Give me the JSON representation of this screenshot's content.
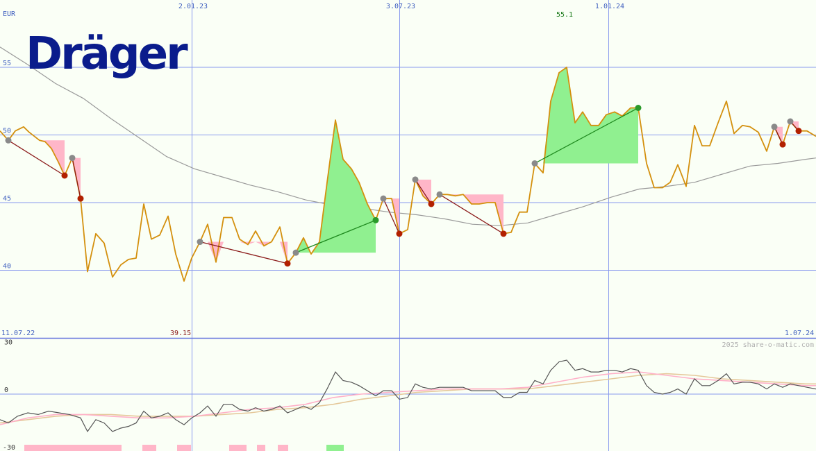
{
  "header": {
    "currency": "EUR",
    "logo_text": "Dräger",
    "copyright": "2025 share-o-matic.com"
  },
  "colors": {
    "background": "#fafff6",
    "grid": "#8899ee",
    "price_line": "#d4900e",
    "moving_average": "#9a9a9a",
    "gain_fill": "#90f090",
    "loss_fill": "#ffb6c8",
    "gain_marker": "#2a9a2a",
    "loss_marker": "#b22000",
    "start_marker": "#8a8a8a",
    "loss_trend": "#8b1a1a",
    "gain_trend": "#1f8a1f",
    "osc_line": "#555555",
    "osc_pink": "#ffb0c8",
    "osc_tan": "#e5c89a",
    "logo": "#0a1c8c",
    "max_label": "#1a7a1a",
    "min_label": "#8b1a1a"
  },
  "chart_data": [
    {
      "type": "line",
      "name": "price",
      "x_range": [
        0,
        1175
      ],
      "ylim": [
        35,
        57.5
      ],
      "y_ticks": [
        40,
        45,
        50,
        55
      ],
      "x_tick_labels": [
        {
          "label": "2.01.23",
          "x": 278
        },
        {
          "label": "3.07.23",
          "x": 577
        },
        {
          "label": "1.01.24",
          "x": 878
        }
      ],
      "date_labels": {
        "start": "11.07.22",
        "end": "1.07.24"
      },
      "max_label": "55.1",
      "min_label": "39.15",
      "price": [
        [
          0,
          50.3
        ],
        [
          12,
          49.6
        ],
        [
          22,
          50.3
        ],
        [
          34,
          50.6
        ],
        [
          42,
          50.2
        ],
        [
          57,
          49.6
        ],
        [
          65,
          49.5
        ],
        [
          74,
          49
        ],
        [
          84,
          48
        ],
        [
          93,
          47
        ],
        [
          104,
          48.3
        ],
        [
          116,
          45.3
        ],
        [
          126,
          39.9
        ],
        [
          138,
          42.7
        ],
        [
          150,
          42
        ],
        [
          162,
          39.5
        ],
        [
          174,
          40.4
        ],
        [
          185,
          40.8
        ],
        [
          196,
          40.9
        ],
        [
          207,
          44.9
        ],
        [
          218,
          42.3
        ],
        [
          230,
          42.6
        ],
        [
          242,
          44
        ],
        [
          253,
          41.2
        ],
        [
          265,
          39.2
        ],
        [
          276,
          40.9
        ],
        [
          288,
          42.1
        ],
        [
          299,
          43.4
        ],
        [
          311,
          40.6
        ],
        [
          322,
          43.9
        ],
        [
          334,
          43.9
        ],
        [
          345,
          42.3
        ],
        [
          357,
          41.9
        ],
        [
          368,
          42.9
        ],
        [
          380,
          41.8
        ],
        [
          391,
          42.1
        ],
        [
          403,
          43.2
        ],
        [
          414,
          40.5
        ],
        [
          426,
          41.3
        ],
        [
          437,
          42.4
        ],
        [
          448,
          41.2
        ],
        [
          460,
          42.1
        ],
        [
          471,
          46.5
        ],
        [
          483,
          51.1
        ],
        [
          494,
          48.2
        ],
        [
          506,
          47.5
        ],
        [
          517,
          46.5
        ],
        [
          529,
          44.9
        ],
        [
          541,
          43.7
        ],
        [
          552,
          45.3
        ],
        [
          564,
          45.3
        ],
        [
          575,
          42.7
        ],
        [
          587,
          43
        ],
        [
          598,
          46.7
        ],
        [
          609,
          45.5
        ],
        [
          621,
          44.9
        ],
        [
          633,
          45.6
        ],
        [
          644,
          45.6
        ],
        [
          656,
          45.5
        ],
        [
          667,
          45.6
        ],
        [
          679,
          44.9
        ],
        [
          690,
          44.9
        ],
        [
          702,
          45
        ],
        [
          713,
          45
        ],
        [
          725,
          42.7
        ],
        [
          736,
          42.8
        ],
        [
          748,
          44.3
        ],
        [
          759,
          44.3
        ],
        [
          770,
          47.9
        ],
        [
          782,
          47.2
        ],
        [
          793,
          52.5
        ],
        [
          805,
          54.6
        ],
        [
          816,
          55
        ],
        [
          828,
          50.9
        ],
        [
          839,
          51.7
        ],
        [
          851,
          50.7
        ],
        [
          862,
          50.7
        ],
        [
          873,
          51.5
        ],
        [
          885,
          51.7
        ],
        [
          896,
          51.4
        ],
        [
          908,
          52
        ],
        [
          919,
          52
        ],
        [
          931,
          47.9
        ],
        [
          942,
          46.1
        ],
        [
          954,
          46.1
        ],
        [
          965,
          46.5
        ],
        [
          976,
          47.8
        ],
        [
          988,
          46.2
        ],
        [
          1000,
          50.7
        ],
        [
          1011,
          49.2
        ],
        [
          1022,
          49.2
        ],
        [
          1034,
          50.9
        ],
        [
          1046,
          52.5
        ],
        [
          1057,
          50.1
        ],
        [
          1069,
          50.7
        ],
        [
          1080,
          50.6
        ],
        [
          1092,
          50.2
        ],
        [
          1104,
          48.8
        ],
        [
          1115,
          50.6
        ],
        [
          1127,
          49.3
        ],
        [
          1138,
          51
        ],
        [
          1150,
          50.3
        ],
        [
          1162,
          50.3
        ],
        [
          1175,
          49.9
        ]
      ],
      "moving_average": [
        [
          0,
          56.5
        ],
        [
          40,
          55.2
        ],
        [
          80,
          53.8
        ],
        [
          120,
          52.7
        ],
        [
          160,
          51.2
        ],
        [
          200,
          49.8
        ],
        [
          240,
          48.4
        ],
        [
          280,
          47.5
        ],
        [
          320,
          46.9
        ],
        [
          360,
          46.3
        ],
        [
          400,
          45.8
        ],
        [
          440,
          45.2
        ],
        [
          480,
          44.8
        ],
        [
          520,
          44.6
        ],
        [
          560,
          44.3
        ],
        [
          600,
          44.1
        ],
        [
          640,
          43.8
        ],
        [
          680,
          43.4
        ],
        [
          720,
          43.3
        ],
        [
          760,
          43.5
        ],
        [
          800,
          44.1
        ],
        [
          840,
          44.7
        ],
        [
          880,
          45.4
        ],
        [
          920,
          46
        ],
        [
          960,
          46.2
        ],
        [
          1000,
          46.5
        ],
        [
          1040,
          47.1
        ],
        [
          1080,
          47.7
        ],
        [
          1120,
          47.9
        ],
        [
          1160,
          48.2
        ],
        [
          1175,
          48.3
        ]
      ],
      "signals": [
        {
          "kind": "loss",
          "x1": 12,
          "y1": 49.6,
          "x2": 93,
          "y2": 47,
          "fill_x": [
            12,
            93
          ],
          "fill_top": 49.6
        },
        {
          "kind": "loss",
          "x1": 104,
          "y1": 48.3,
          "x2": 116,
          "y2": 45.3,
          "fill_x": [
            104,
            116
          ],
          "fill_top": 48.3
        },
        {
          "kind": "loss",
          "x1": 288,
          "y1": 42.1,
          "x2": 414,
          "y2": 40.5,
          "fill_x": [
            288,
            414
          ],
          "fill_top": 42.1
        },
        {
          "kind": "gain",
          "x1": 426,
          "y1": 41.3,
          "x2": 541,
          "y2": 43.7,
          "fill_x": [
            426,
            541
          ],
          "fill_bottom": 41.3
        },
        {
          "kind": "loss",
          "x1": 552,
          "y1": 45.3,
          "x2": 575,
          "y2": 42.7,
          "fill_x": [
            552,
            575
          ],
          "fill_top": 45.3
        },
        {
          "kind": "loss",
          "x1": 598,
          "y1": 46.7,
          "x2": 621,
          "y2": 44.9,
          "fill_x": [
            598,
            621
          ],
          "fill_top": 46.7
        },
        {
          "kind": "loss",
          "x1": 633,
          "y1": 45.6,
          "x2": 725,
          "y2": 42.7,
          "fill_x": [
            633,
            725
          ],
          "fill_top": 45.6
        },
        {
          "kind": "gain",
          "x1": 770,
          "y1": 47.9,
          "x2": 919,
          "y2": 52,
          "fill_x": [
            770,
            919
          ],
          "fill_bottom": 47.9
        },
        {
          "kind": "loss",
          "x1": 1115,
          "y1": 50.6,
          "x2": 1127,
          "y2": 49.3,
          "fill_x": [
            1115,
            1127
          ],
          "fill_top": 50.6
        },
        {
          "kind": "loss",
          "x1": 1138,
          "y1": 51,
          "x2": 1150,
          "y2": 50.3,
          "fill_x": [
            1138,
            1150
          ],
          "fill_top": 51
        }
      ]
    },
    {
      "type": "line",
      "name": "oscillator",
      "ylim": [
        -32,
        33
      ],
      "y_ticks": [
        30,
        0,
        -30
      ],
      "series_main": [
        [
          0,
          -15
        ],
        [
          12,
          -17
        ],
        [
          25,
          -13
        ],
        [
          40,
          -11
        ],
        [
          55,
          -12
        ],
        [
          70,
          -10
        ],
        [
          85,
          -11
        ],
        [
          100,
          -12
        ],
        [
          116,
          -14
        ],
        [
          126,
          -22
        ],
        [
          138,
          -15
        ],
        [
          150,
          -17
        ],
        [
          162,
          -22
        ],
        [
          174,
          -20
        ],
        [
          185,
          -19
        ],
        [
          196,
          -17
        ],
        [
          207,
          -10
        ],
        [
          218,
          -14
        ],
        [
          230,
          -13
        ],
        [
          242,
          -11
        ],
        [
          253,
          -15
        ],
        [
          265,
          -18
        ],
        [
          276,
          -14
        ],
        [
          288,
          -11
        ],
        [
          299,
          -7
        ],
        [
          311,
          -13
        ],
        [
          322,
          -6
        ],
        [
          334,
          -6
        ],
        [
          345,
          -9
        ],
        [
          357,
          -10
        ],
        [
          368,
          -8
        ],
        [
          380,
          -10
        ],
        [
          391,
          -9
        ],
        [
          403,
          -7
        ],
        [
          414,
          -11
        ],
        [
          426,
          -9
        ],
        [
          437,
          -7
        ],
        [
          448,
          -9
        ],
        [
          460,
          -5
        ],
        [
          471,
          3
        ],
        [
          483,
          13
        ],
        [
          494,
          8
        ],
        [
          506,
          7
        ],
        [
          517,
          5
        ],
        [
          529,
          2
        ],
        [
          541,
          -1
        ],
        [
          552,
          2
        ],
        [
          564,
          2
        ],
        [
          575,
          -3
        ],
        [
          587,
          -2
        ],
        [
          598,
          6
        ],
        [
          609,
          4
        ],
        [
          621,
          3
        ],
        [
          633,
          4
        ],
        [
          644,
          4
        ],
        [
          656,
          4
        ],
        [
          667,
          4
        ],
        [
          679,
          2
        ],
        [
          690,
          2
        ],
        [
          702,
          2
        ],
        [
          713,
          2
        ],
        [
          725,
          -2
        ],
        [
          736,
          -2
        ],
        [
          748,
          1
        ],
        [
          759,
          1
        ],
        [
          770,
          8
        ],
        [
          782,
          6
        ],
        [
          793,
          14
        ],
        [
          805,
          19
        ],
        [
          816,
          20
        ],
        [
          828,
          14
        ],
        [
          839,
          15
        ],
        [
          851,
          13
        ],
        [
          862,
          13
        ],
        [
          873,
          14
        ],
        [
          885,
          14
        ],
        [
          896,
          13
        ],
        [
          908,
          15
        ],
        [
          919,
          14
        ],
        [
          931,
          5
        ],
        [
          942,
          1
        ],
        [
          954,
          0
        ],
        [
          965,
          1
        ],
        [
          976,
          3
        ],
        [
          988,
          0
        ],
        [
          1000,
          9
        ],
        [
          1011,
          5
        ],
        [
          1022,
          5
        ],
        [
          1034,
          8
        ],
        [
          1046,
          12
        ],
        [
          1057,
          6
        ],
        [
          1069,
          7
        ],
        [
          1080,
          7
        ],
        [
          1092,
          6
        ],
        [
          1104,
          3
        ],
        [
          1115,
          6
        ],
        [
          1127,
          4
        ],
        [
          1138,
          6
        ],
        [
          1150,
          5
        ],
        [
          1162,
          4
        ],
        [
          1175,
          3
        ]
      ],
      "series_pink": [
        [
          0,
          -18
        ],
        [
          40,
          -14
        ],
        [
          80,
          -12
        ],
        [
          120,
          -12
        ],
        [
          160,
          -13
        ],
        [
          200,
          -14
        ],
        [
          240,
          -14
        ],
        [
          280,
          -13
        ],
        [
          320,
          -11
        ],
        [
          360,
          -9
        ],
        [
          400,
          -8
        ],
        [
          440,
          -6
        ],
        [
          480,
          -2
        ],
        [
          520,
          0
        ],
        [
          560,
          1
        ],
        [
          600,
          2
        ],
        [
          640,
          3
        ],
        [
          680,
          3
        ],
        [
          720,
          3
        ],
        [
          760,
          4
        ],
        [
          800,
          7
        ],
        [
          840,
          10
        ],
        [
          880,
          12
        ],
        [
          920,
          13
        ],
        [
          960,
          11
        ],
        [
          1000,
          9
        ],
        [
          1040,
          8
        ],
        [
          1080,
          7
        ],
        [
          1120,
          6
        ],
        [
          1160,
          5
        ],
        [
          1175,
          5
        ]
      ],
      "series_tan": [
        [
          0,
          -17
        ],
        [
          40,
          -15
        ],
        [
          80,
          -13
        ],
        [
          120,
          -12
        ],
        [
          160,
          -12
        ],
        [
          200,
          -13
        ],
        [
          240,
          -13
        ],
        [
          280,
          -13
        ],
        [
          320,
          -12
        ],
        [
          360,
          -11
        ],
        [
          400,
          -9
        ],
        [
          440,
          -8
        ],
        [
          480,
          -6
        ],
        [
          520,
          -3
        ],
        [
          560,
          -1
        ],
        [
          600,
          1
        ],
        [
          640,
          2
        ],
        [
          680,
          3
        ],
        [
          720,
          3
        ],
        [
          760,
          3
        ],
        [
          800,
          5
        ],
        [
          840,
          7
        ],
        [
          880,
          9
        ],
        [
          920,
          11
        ],
        [
          960,
          12
        ],
        [
          1000,
          11
        ],
        [
          1040,
          9
        ],
        [
          1080,
          8
        ],
        [
          1120,
          7
        ],
        [
          1160,
          6
        ],
        [
          1175,
          6
        ]
      ],
      "volume_bars": [
        {
          "x1": 35,
          "x2": 175,
          "kind": "loss"
        },
        {
          "x1": 205,
          "x2": 225,
          "kind": "loss"
        },
        {
          "x1": 255,
          "x2": 275,
          "kind": "loss"
        },
        {
          "x1": 330,
          "x2": 355,
          "kind": "loss"
        },
        {
          "x1": 370,
          "x2": 382,
          "kind": "loss"
        },
        {
          "x1": 400,
          "x2": 415,
          "kind": "loss"
        },
        {
          "x1": 470,
          "x2": 495,
          "kind": "gain"
        }
      ]
    }
  ]
}
